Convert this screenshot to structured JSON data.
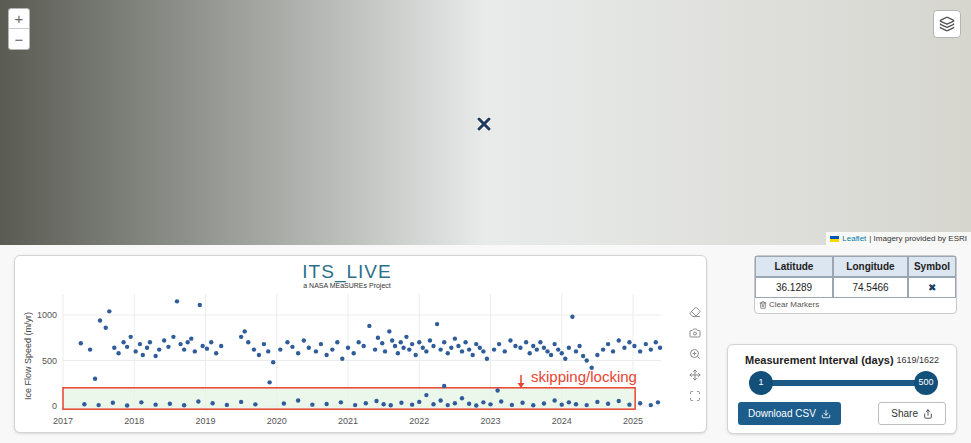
{
  "map": {
    "zoom_in": "+",
    "zoom_out": "−",
    "attribution": {
      "link": "Leaflet",
      "text": "| Imagery provided by ESRI"
    }
  },
  "chart": {
    "title": "ITS_LIVE",
    "subtitle": "a NASA MEaSUREs Project",
    "y_axis_title": "Ice Flow Speed (m/yr)",
    "y_ticks": [
      "0",
      "500",
      "1000"
    ],
    "x_ticks": [
      "2017",
      "2018",
      "2019",
      "2020",
      "2021",
      "2022",
      "2023",
      "2024",
      "2025"
    ],
    "annotation": {
      "label": "skipping/locking",
      "y_min": -35,
      "y_max": 200,
      "x_min": 2017,
      "x_max": 2025.03
    },
    "series": [
      {
        "points": [
          [
            2017.25,
            690
          ],
          [
            2017.38,
            620
          ],
          [
            2017.45,
            300
          ],
          [
            2017.52,
            940
          ],
          [
            2017.6,
            860
          ],
          [
            2017.65,
            1040
          ],
          [
            2017.72,
            640
          ],
          [
            2017.78,
            580
          ],
          [
            2017.85,
            700
          ],
          [
            2017.9,
            650
          ],
          [
            2017.95,
            760
          ],
          [
            2018.02,
            600
          ],
          [
            2018.08,
            680
          ],
          [
            2018.12,
            560
          ],
          [
            2018.18,
            640
          ],
          [
            2018.22,
            700
          ],
          [
            2018.3,
            550
          ],
          [
            2018.35,
            620
          ],
          [
            2018.42,
            720
          ],
          [
            2018.48,
            650
          ],
          [
            2018.55,
            760
          ],
          [
            2018.6,
            1150
          ],
          [
            2018.65,
            680
          ],
          [
            2018.7,
            620
          ],
          [
            2018.75,
            700
          ],
          [
            2018.8,
            740
          ],
          [
            2018.85,
            600
          ],
          [
            2018.92,
            1110
          ],
          [
            2018.96,
            660
          ],
          [
            2019.02,
            630
          ],
          [
            2019.08,
            700
          ],
          [
            2019.15,
            580
          ],
          [
            2019.22,
            660
          ],
          [
            2019.5,
            760
          ],
          [
            2019.55,
            820
          ],
          [
            2019.6,
            700
          ],
          [
            2019.68,
            620
          ],
          [
            2019.75,
            560
          ],
          [
            2019.82,
            680
          ],
          [
            2019.88,
            600
          ],
          [
            2019.95,
            480
          ],
          [
            2020.05,
            620
          ],
          [
            2020.15,
            700
          ],
          [
            2020.22,
            650
          ],
          [
            2020.3,
            580
          ],
          [
            2020.38,
            720
          ],
          [
            2020.45,
            640
          ],
          [
            2020.55,
            600
          ],
          [
            2020.62,
            680
          ],
          [
            2020.7,
            560
          ],
          [
            2020.78,
            620
          ],
          [
            2020.85,
            700
          ],
          [
            2020.92,
            520
          ],
          [
            2021.0,
            640
          ],
          [
            2021.08,
            580
          ],
          [
            2021.15,
            700
          ],
          [
            2021.22,
            660
          ],
          [
            2021.3,
            880
          ],
          [
            2021.38,
            620
          ],
          [
            2021.42,
            750
          ],
          [
            2021.48,
            690
          ],
          [
            2021.52,
            600
          ],
          [
            2021.58,
            820
          ],
          [
            2021.62,
            720
          ],
          [
            2021.66,
            660
          ],
          [
            2021.7,
            580
          ],
          [
            2021.74,
            700
          ],
          [
            2021.78,
            640
          ],
          [
            2021.82,
            760
          ],
          [
            2021.86,
            620
          ],
          [
            2021.9,
            680
          ],
          [
            2021.95,
            560
          ],
          [
            2022.0,
            700
          ],
          [
            2022.05,
            640
          ],
          [
            2022.1,
            600
          ],
          [
            2022.15,
            720
          ],
          [
            2022.2,
            660
          ],
          [
            2022.25,
            900
          ],
          [
            2022.3,
            620
          ],
          [
            2022.35,
            700
          ],
          [
            2022.4,
            580
          ],
          [
            2022.45,
            640
          ],
          [
            2022.5,
            740
          ],
          [
            2022.55,
            660
          ],
          [
            2022.6,
            600
          ],
          [
            2022.65,
            700
          ],
          [
            2022.7,
            620
          ],
          [
            2022.75,
            560
          ],
          [
            2022.8,
            680
          ],
          [
            2022.85,
            640
          ],
          [
            2022.9,
            600
          ],
          [
            2022.95,
            520
          ],
          [
            2023.05,
            620
          ],
          [
            2023.12,
            680
          ],
          [
            2023.2,
            600
          ],
          [
            2023.28,
            720
          ],
          [
            2023.35,
            660
          ],
          [
            2023.42,
            640
          ],
          [
            2023.5,
            700
          ],
          [
            2023.55,
            580
          ],
          [
            2023.6,
            660
          ],
          [
            2023.65,
            620
          ],
          [
            2023.7,
            700
          ],
          [
            2023.75,
            640
          ],
          [
            2023.8,
            600
          ],
          [
            2023.85,
            560
          ],
          [
            2023.9,
            680
          ],
          [
            2023.95,
            620
          ],
          [
            2024.0,
            580
          ],
          [
            2024.05,
            520
          ],
          [
            2024.1,
            640
          ],
          [
            2024.15,
            980
          ],
          [
            2024.2,
            600
          ],
          [
            2024.25,
            660
          ],
          [
            2024.3,
            550
          ],
          [
            2024.35,
            500
          ],
          [
            2024.42,
            420
          ],
          [
            2024.5,
            560
          ],
          [
            2024.58,
            620
          ],
          [
            2024.65,
            680
          ],
          [
            2024.72,
            600
          ],
          [
            2024.8,
            720
          ],
          [
            2024.88,
            640
          ],
          [
            2024.95,
            700
          ],
          [
            2025.02,
            660
          ],
          [
            2025.1,
            600
          ],
          [
            2025.18,
            680
          ],
          [
            2025.25,
            620
          ],
          [
            2025.32,
            700
          ],
          [
            2025.38,
            640
          ],
          [
            2017.3,
            20
          ],
          [
            2017.5,
            10
          ],
          [
            2017.7,
            35
          ],
          [
            2017.9,
            5
          ],
          [
            2018.1,
            40
          ],
          [
            2018.3,
            15
          ],
          [
            2018.5,
            25
          ],
          [
            2018.7,
            8
          ],
          [
            2018.9,
            50
          ],
          [
            2019.1,
            30
          ],
          [
            2019.3,
            12
          ],
          [
            2019.5,
            45
          ],
          [
            2019.7,
            18
          ],
          [
            2019.9,
            260
          ],
          [
            2020.1,
            28
          ],
          [
            2020.3,
            60
          ],
          [
            2020.5,
            15
          ],
          [
            2020.7,
            22
          ],
          [
            2020.9,
            40
          ],
          [
            2021.1,
            10
          ],
          [
            2021.25,
            30
          ],
          [
            2021.4,
            55
          ],
          [
            2021.5,
            20
          ],
          [
            2021.6,
            8
          ],
          [
            2021.75,
            35
          ],
          [
            2021.9,
            15
          ],
          [
            2022.0,
            45
          ],
          [
            2022.1,
            120
          ],
          [
            2022.2,
            20
          ],
          [
            2022.3,
            60
          ],
          [
            2022.35,
            220
          ],
          [
            2022.4,
            10
          ],
          [
            2022.5,
            30
          ],
          [
            2022.6,
            85
          ],
          [
            2022.7,
            25
          ],
          [
            2022.8,
            5
          ],
          [
            2022.9,
            40
          ],
          [
            2023.0,
            18
          ],
          [
            2023.1,
            170
          ],
          [
            2023.15,
            50
          ],
          [
            2023.3,
            12
          ],
          [
            2023.45,
            35
          ],
          [
            2023.6,
            8
          ],
          [
            2023.75,
            28
          ],
          [
            2023.9,
            60
          ],
          [
            2024.0,
            15
          ],
          [
            2024.1,
            40
          ],
          [
            2024.2,
            20
          ],
          [
            2024.35,
            10
          ],
          [
            2024.5,
            45
          ],
          [
            2024.65,
            25
          ],
          [
            2024.8,
            55
          ],
          [
            2024.95,
            15
          ],
          [
            2025.1,
            30
          ],
          [
            2025.25,
            10
          ],
          [
            2025.35,
            40
          ]
        ]
      }
    ]
  },
  "markers_table": {
    "columns": [
      "Latitude",
      "Longitude",
      "Symbol"
    ],
    "rows": [
      {
        "latitude": "36.1289",
        "longitude": "74.5466",
        "symbol": "✖"
      }
    ],
    "clear_button": "Clear Markers"
  },
  "interval": {
    "title": "Measurement Interval (days)",
    "count": "1619/1622",
    "min_label": "1",
    "max_label": "500",
    "level_low": 0,
    "level_high": 1
  },
  "buttons": {
    "download": "Download CSV",
    "share": "Share"
  }
}
